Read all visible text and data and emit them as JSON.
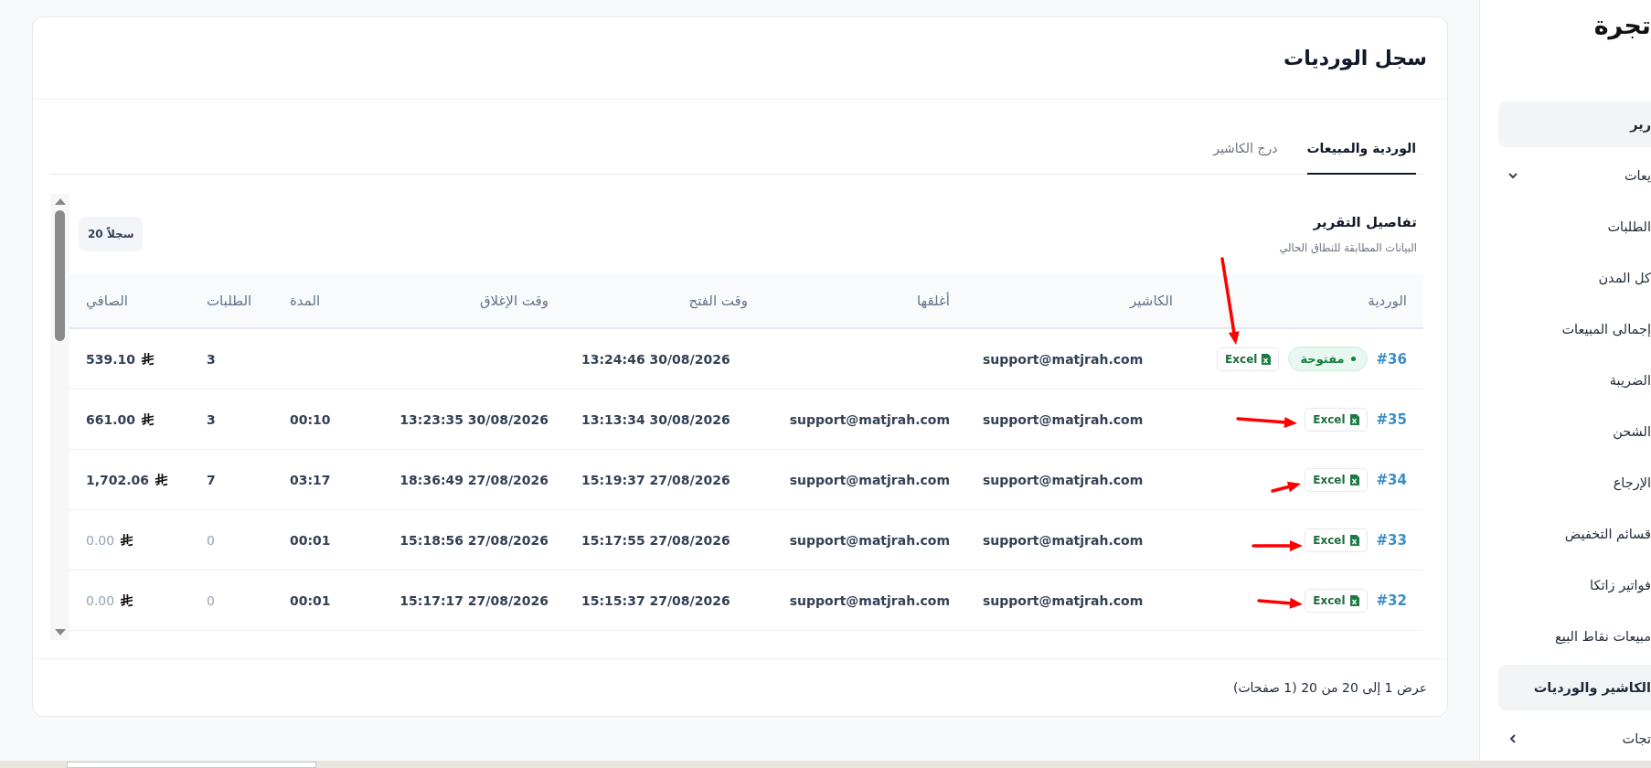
{
  "page": {
    "title": "سجل الورديات",
    "tabs": [
      {
        "label": "الوردية والمبيعات",
        "selected": true
      },
      {
        "label": "درج الكاشير",
        "selected": false
      }
    ],
    "report": {
      "title": "تفاصيل التقرير",
      "subtitle": "البيانات المطابقة للنطاق الحالي",
      "count_badge": "سجلاً 20"
    },
    "table": {
      "columns": [
        "الوردية",
        "الكاشير",
        "أغلقها",
        "وقت الفتح",
        "وقت الإغلاق",
        "المدة",
        "الطلبات",
        "الصافي"
      ],
      "rows": [
        {
          "shift": "#36",
          "status": "مفتوحة",
          "export": "Excel",
          "cashier": "support@matjrah.com",
          "opened": "13:24:46 30/08/2026",
          "orders": "3",
          "net": "539.10",
          "dimmed": false
        },
        {
          "shift": "#35",
          "export": "Excel",
          "cashier": "support@matjrah.com",
          "closed_by": "support@matjrah.com",
          "opened": "13:13:34 30/08/2026",
          "closed": "13:23:35 30/08/2026",
          "duration": "00:10",
          "orders": "3",
          "net": "661.00",
          "dimmed": false
        },
        {
          "shift": "#34",
          "export": "Excel",
          "cashier": "support@matjrah.com",
          "closed_by": "support@matjrah.com",
          "opened": "15:19:37 27/08/2026",
          "closed": "18:36:49 27/08/2026",
          "duration": "03:17",
          "orders": "7",
          "net": "1,702.06",
          "dimmed": false
        },
        {
          "shift": "#33",
          "export": "Excel",
          "cashier": "support@matjrah.com",
          "closed_by": "support@matjrah.com",
          "opened": "15:17:55 27/08/2026",
          "closed": "15:18:56 27/08/2026",
          "duration": "00:01",
          "orders": "0",
          "net": "0.00",
          "dimmed": true
        },
        {
          "shift": "#32",
          "export": "Excel",
          "cashier": "support@matjrah.com",
          "closed_by": "support@matjrah.com",
          "opened": "15:15:37 27/08/2026",
          "closed": "15:17:17 27/08/2026",
          "duration": "00:01",
          "orders": "0",
          "net": "0.00",
          "dimmed": true
        }
      ]
    },
    "footer": "عرض 1 إلى 20 من 20 (1 صفحات)"
  },
  "sidebar": {
    "brand": "تجرة",
    "items": [
      {
        "label": "رير",
        "kind": "link",
        "selected": true
      },
      {
        "label": "يعات",
        "kind": "group",
        "expanded": true,
        "selected": false
      },
      {
        "label": "الطلبات",
        "kind": "link",
        "selected": false
      },
      {
        "label": "كل المدن",
        "kind": "link",
        "selected": false
      },
      {
        "label": "إجمالى المبيعات",
        "kind": "link",
        "selected": false
      },
      {
        "label": "الضريبة",
        "kind": "link",
        "selected": false
      },
      {
        "label": "الشحن",
        "kind": "link",
        "selected": false
      },
      {
        "label": "الإرجاع",
        "kind": "link",
        "selected": false
      },
      {
        "label": "قسائم التخفيض",
        "kind": "link",
        "selected": false
      },
      {
        "label": "فواتير زاتكا",
        "kind": "link",
        "selected": false
      },
      {
        "label": "مبيعات نقاط البيع",
        "kind": "link",
        "selected": false
      },
      {
        "label": "الكاشير والورديات",
        "kind": "link",
        "selected": true
      },
      {
        "label": "تجات",
        "kind": "group",
        "expanded": false,
        "selected": false
      }
    ]
  }
}
